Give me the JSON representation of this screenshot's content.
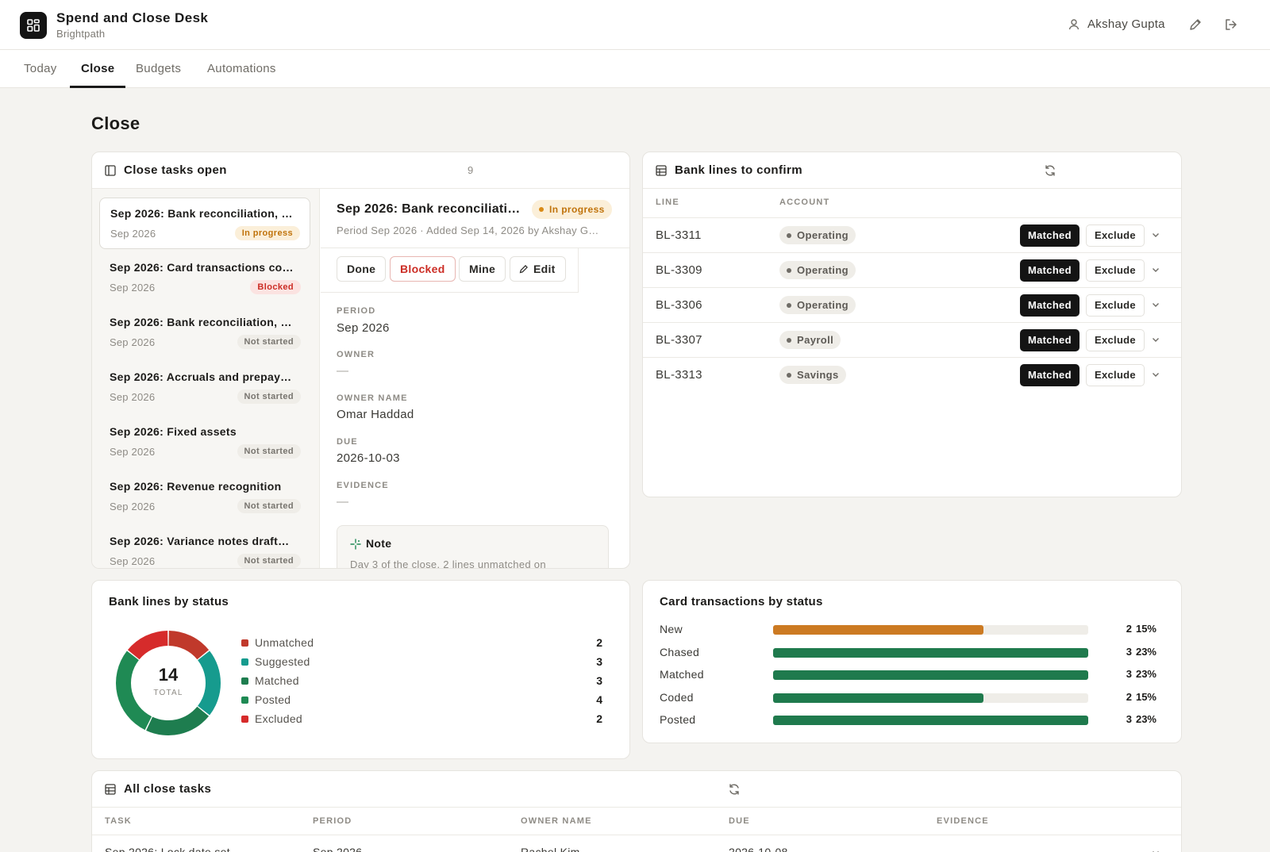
{
  "app": {
    "title": "Spend and Close Desk",
    "org": "Brightpath",
    "user": "Akshay Gupta",
    "icons": [
      "dashboard-icon",
      "user-icon",
      "pencil-icon",
      "logout-icon"
    ]
  },
  "tabs": [
    {
      "label": "Today",
      "active": false
    },
    {
      "label": "Close",
      "active": true
    },
    {
      "label": "Budgets",
      "active": false
    },
    {
      "label": "Automations",
      "active": false
    }
  ],
  "page": {
    "title": "Close"
  },
  "close_tasks": {
    "title": "Close tasks open",
    "count": "9",
    "items": [
      {
        "name": "Sep 2026: Bank reconciliation, …",
        "period": "Sep 2026",
        "status": "In progress"
      },
      {
        "name": "Sep 2026: Card transactions co…",
        "period": "Sep 2026",
        "status": "Blocked"
      },
      {
        "name": "Sep 2026: Bank reconciliation, …",
        "period": "Sep 2026",
        "status": "Not started"
      },
      {
        "name": "Sep 2026: Accruals and prepay…",
        "period": "Sep 2026",
        "status": "Not started"
      },
      {
        "name": "Sep 2026: Fixed assets",
        "period": "Sep 2026",
        "status": "Not started"
      },
      {
        "name": "Sep 2026: Revenue recognition",
        "period": "Sep 2026",
        "status": "Not started"
      },
      {
        "name": "Sep 2026: Variance notes draft…",
        "period": "Sep 2026",
        "status": "Not started"
      }
    ],
    "detail": {
      "title": "Sep 2026: Bank reconciliati…",
      "status": "In progress",
      "subtitle": "Period Sep 2026  ·  Added Sep 14, 2026 by Akshay G…",
      "actions": {
        "done": "Done",
        "blocked": "Blocked",
        "mine": "Mine",
        "edit": "Edit"
      },
      "fields": {
        "period_label": "PERIOD",
        "period": "Sep 2026",
        "owner_label": "OWNER",
        "owner": "—",
        "owner_name_label": "OWNER NAME",
        "owner_name": "Omar Haddad",
        "due_label": "DUE",
        "due": "2026-10-03",
        "evidence_label": "EVIDENCE",
        "evidence": "—"
      },
      "note": {
        "title": "Note",
        "text": "Day 3 of the close. 2 lines unmatched on"
      }
    }
  },
  "bank_lines": {
    "title": "Bank lines to confirm",
    "columns": {
      "line": "LINE",
      "account": "ACCOUNT"
    },
    "matched_label": "Matched",
    "exclude_label": "Exclude",
    "rows": [
      {
        "line": "BL-3311",
        "account": "Operating"
      },
      {
        "line": "BL-3309",
        "account": "Operating"
      },
      {
        "line": "BL-3306",
        "account": "Operating"
      },
      {
        "line": "BL-3307",
        "account": "Payroll"
      },
      {
        "line": "BL-3313",
        "account": "Savings"
      }
    ]
  },
  "bank_status_chart": {
    "title": "Bank lines by status",
    "total": "14",
    "total_label": "TOTAL"
  },
  "card_status_chart": {
    "title": "Card transactions by status"
  },
  "chart_data": [
    {
      "type": "pie",
      "title": "Bank lines by status",
      "categories": [
        "Unmatched",
        "Suggested",
        "Matched",
        "Posted",
        "Excluded"
      ],
      "values": [
        2,
        3,
        3,
        4,
        2
      ],
      "colors": [
        "#c0392b",
        "#169b8e",
        "#1e7d4f",
        "#1f8a54",
        "#d62b2b"
      ],
      "legend": "right"
    },
    {
      "type": "bar",
      "title": "Card transactions by status",
      "categories": [
        "New",
        "Chased",
        "Matched",
        "Coded",
        "Posted"
      ],
      "values": [
        2,
        3,
        3,
        2,
        3
      ],
      "percents": [
        "15%",
        "23%",
        "23%",
        "15%",
        "23%"
      ],
      "colors": [
        "#cc7a22",
        "#1f7a4d",
        "#1f7a4d",
        "#1f7a4d",
        "#1f7a4d"
      ],
      "xlim": [
        0,
        3
      ]
    }
  ],
  "all_tasks": {
    "title": "All close tasks",
    "columns": {
      "task": "TASK",
      "period": "PERIOD",
      "owner_name": "OWNER NAME",
      "due": "DUE",
      "evidence": "EVIDENCE"
    },
    "rows": [
      {
        "task": "Sep 2026: Lock date set",
        "period": "Sep 2026",
        "owner_name": "Rachel Kim",
        "due": "2026-10-08"
      }
    ]
  }
}
